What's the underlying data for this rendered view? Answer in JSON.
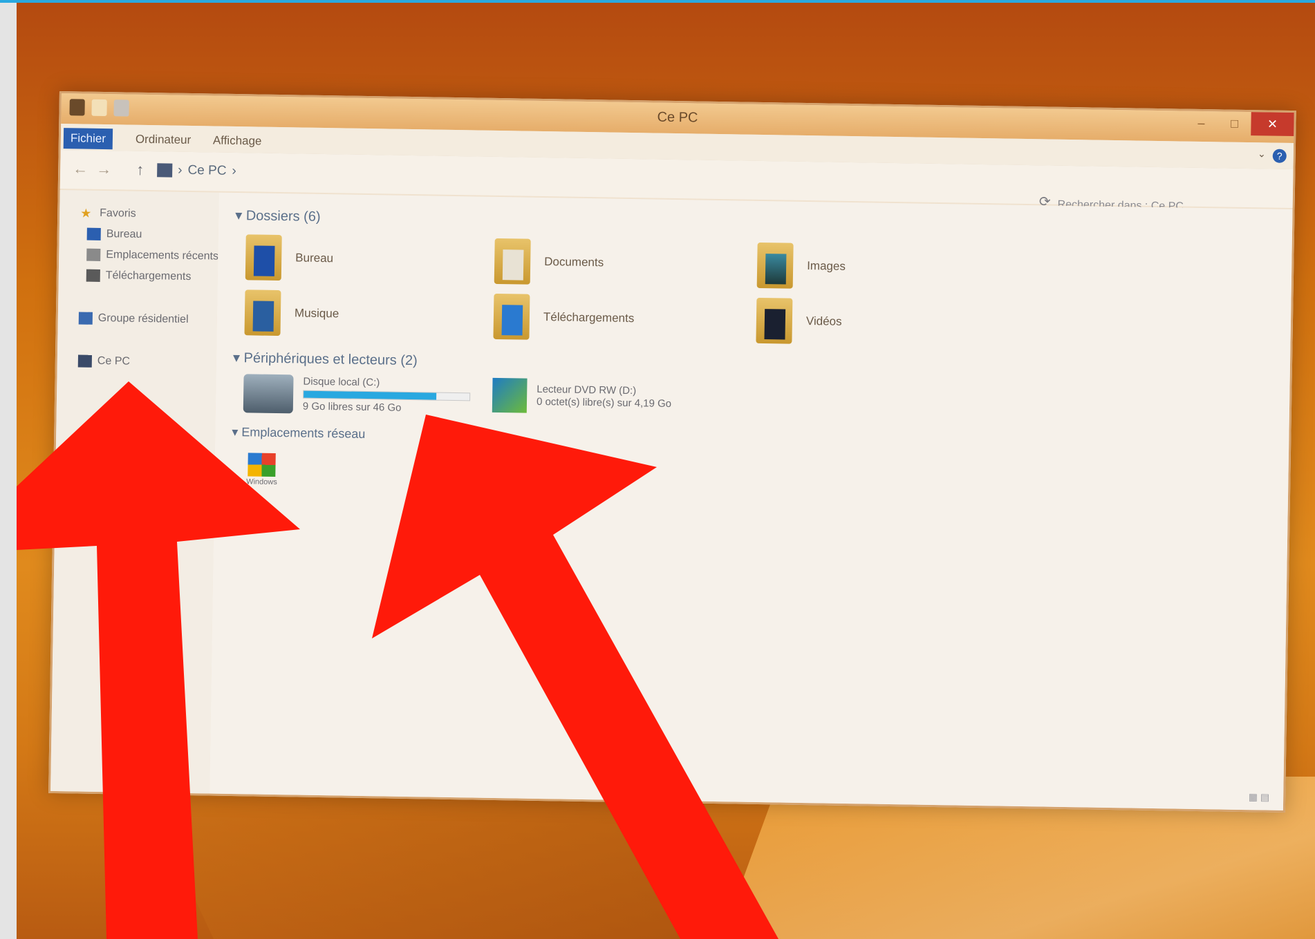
{
  "window": {
    "title": "Ce PC"
  },
  "ribbon": {
    "tabs": [
      {
        "label": "Fichier"
      },
      {
        "label": "Ordinateur"
      },
      {
        "label": "Affichage"
      }
    ],
    "help": "?",
    "minimize": "⌄"
  },
  "address": {
    "back": "←",
    "forward": "→",
    "up": "↑",
    "path": [
      "Ce PC"
    ],
    "refresh": "⟳",
    "search_placeholder": "Rechercher dans : Ce PC"
  },
  "nav": {
    "items": [
      {
        "label": "Favoris",
        "icon": "star-icon"
      },
      {
        "label": "Bureau",
        "icon": "desktop-icon"
      },
      {
        "label": "Emplacements récents",
        "icon": "recent-icon"
      },
      {
        "label": "Téléchargements",
        "icon": "download-icon"
      },
      {
        "label": "Groupe résidentiel",
        "icon": "homegroup-icon"
      },
      {
        "label": "Ce PC",
        "icon": "pc-icon"
      }
    ]
  },
  "content": {
    "folders_header": "Dossiers (6)",
    "folders": [
      {
        "label": "Bureau",
        "icon": "desktop-folder-icon"
      },
      {
        "label": "Documents",
        "icon": "documents-folder-icon"
      },
      {
        "label": "Images",
        "icon": "pictures-folder-icon"
      },
      {
        "label": "Musique",
        "icon": "music-folder-icon"
      },
      {
        "label": "Téléchargements",
        "icon": "downloads-folder-icon"
      },
      {
        "label": "Vidéos",
        "icon": "videos-folder-icon"
      }
    ],
    "devices_header": "Périphériques et lecteurs (2)",
    "devices": [
      {
        "label": "Disque local (C:)",
        "detail": "9 Go libres sur 46 Go",
        "used_fraction": 0.8,
        "icon": "hard-drive-icon"
      },
      {
        "label": "Lecteur DVD RW (D:)",
        "detail": "0 octet(s) libre(s) sur 4,19 Go",
        "icon": "dvd-drive-icon"
      }
    ],
    "network_header": "Emplacements réseau",
    "network": [
      {
        "label": "Windows",
        "icon": "windows-media-icon"
      }
    ]
  },
  "colors": {
    "accent": "#2b5fb0",
    "annotation_arrow": "#ff1a0a",
    "top_line": "#29a8e0"
  }
}
